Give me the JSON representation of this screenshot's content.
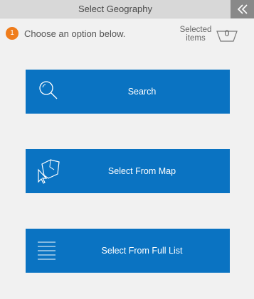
{
  "header": {
    "title": "Select Geography",
    "collapse_icon": "double-chevron-left-icon"
  },
  "step": {
    "number": "1",
    "text": "Choose an option below.",
    "badge_color": "#ef7c1b"
  },
  "selected": {
    "label_line1": "Selected",
    "label_line2": "items",
    "count": "0",
    "icon": "basket-icon"
  },
  "options": {
    "search": {
      "label": "Search",
      "icon": "magnifier-icon"
    },
    "map": {
      "label": "Select From Map",
      "icon": "map-select-icon"
    },
    "list": {
      "label": "Select From Full List",
      "icon": "list-icon"
    }
  },
  "colors": {
    "button": "#0a73c2",
    "header": "#d8d8d8",
    "background": "#f1f1f1"
  }
}
